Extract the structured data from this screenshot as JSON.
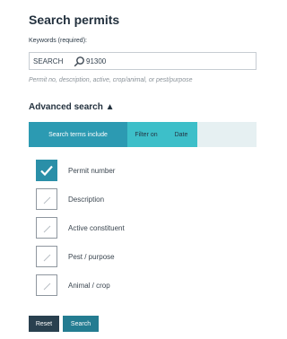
{
  "title": "Search permits",
  "keywords": {
    "label": "Keywords (required):",
    "prefix": "SEARCH",
    "value": "91300",
    "hint": "Permit no, description, active, crop/animal, or pest/purpose"
  },
  "advanced": {
    "label": "Advanced search ▲"
  },
  "tabs": [
    {
      "label": "Search terms include"
    },
    {
      "label": "Filter on"
    },
    {
      "label": "Date"
    }
  ],
  "checkboxes": [
    {
      "label": "Permit number",
      "checked": true
    },
    {
      "label": "Description",
      "checked": false
    },
    {
      "label": "Active constituent",
      "checked": false
    },
    {
      "label": "Pest / purpose",
      "checked": false
    },
    {
      "label": "Animal / crop",
      "checked": false
    }
  ],
  "buttons": {
    "reset": "Reset",
    "search": "Search"
  },
  "colors": {
    "tab_active": "#2c9ab2",
    "tab_inactive": "#3dbfc9",
    "checkbox_checked": "#2a8fa8",
    "reset_button": "#29404f",
    "search_button": "#247c91"
  },
  "icons": {
    "search": "search-icon",
    "checkmark": "checkmark-icon",
    "checkbox_mark": "pencil-mark-icon"
  }
}
